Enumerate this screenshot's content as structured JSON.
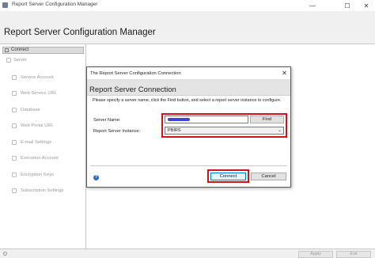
{
  "window": {
    "title": "Report Server Configuration Manager",
    "min_glyph": "—",
    "max_glyph": "☐",
    "close_glyph": "✕"
  },
  "header": {
    "title": "Report Server Configuration Manager"
  },
  "sidebar": {
    "connect_label": "Connect",
    "server_label": "Server",
    "items": [
      {
        "label": "Service Account",
        "icon": "service-account-icon"
      },
      {
        "label": "Web Service URL",
        "icon": "web-service-icon"
      },
      {
        "label": "Database",
        "icon": "database-icon"
      },
      {
        "label": "Web Portal URL",
        "icon": "web-portal-icon"
      },
      {
        "label": "E-mail Settings",
        "icon": "email-icon"
      },
      {
        "label": "Execution Account",
        "icon": "execution-account-icon"
      },
      {
        "label": "Encryption Keys",
        "icon": "encryption-keys-icon"
      },
      {
        "label": "Subscription Settings",
        "icon": "subscription-icon"
      }
    ]
  },
  "footer": {
    "apply_label": "Apply",
    "exit_label": "Exit"
  },
  "dialog": {
    "title": "The Report Server Configuration Connection",
    "close_glyph": "✕",
    "heading": "Report Server Connection",
    "instructions": "Please specify a server name, click the Find button, and select a report server instance to configure.",
    "server_name_label": "Server Name:",
    "server_name_value": "",
    "find_label": "Find",
    "instance_label": "Report Server Instance:",
    "instance_value": "PBIRS",
    "instance_caret": "⌄",
    "help_glyph": "?",
    "connect_label": "Connect",
    "cancel_label": "Cancel"
  },
  "colors": {
    "highlight": "#d0121c",
    "redaction": "#3b46d8",
    "accent": "#0078d7"
  }
}
